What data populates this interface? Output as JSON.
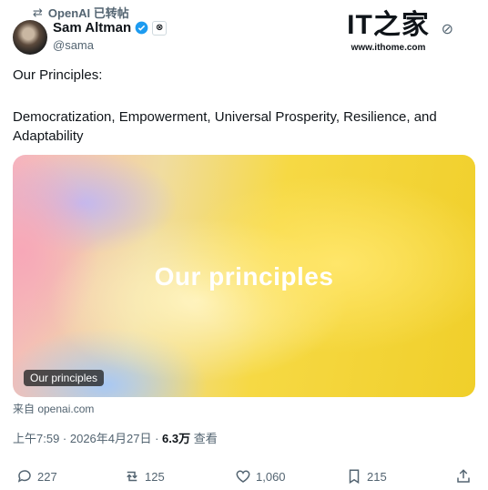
{
  "repost": {
    "label": "OpenAI 已转帖"
  },
  "author": {
    "name": "Sam Altman",
    "handle": "@sama"
  },
  "watermark": {
    "logo": "IT之家",
    "url": "www.ithome.com"
  },
  "post": {
    "line1": "Our Principles:",
    "line2": "Democratization, Empowerment, Universal Prosperity, Resilience, and Adaptability"
  },
  "card": {
    "title": "Our principles",
    "tag": "Our principles",
    "source": "来自 openai.com"
  },
  "meta": {
    "time": "上午7:59 · 2026年4月27日 · ",
    "views": "6.3万",
    "views_label": " 查看"
  },
  "actions": {
    "replies": "227",
    "reposts": "125",
    "likes": "1,060",
    "bookmarks": "215"
  },
  "colors": {
    "text": "#0f1419",
    "muted": "#536471",
    "verified": "#1d9bf0"
  }
}
